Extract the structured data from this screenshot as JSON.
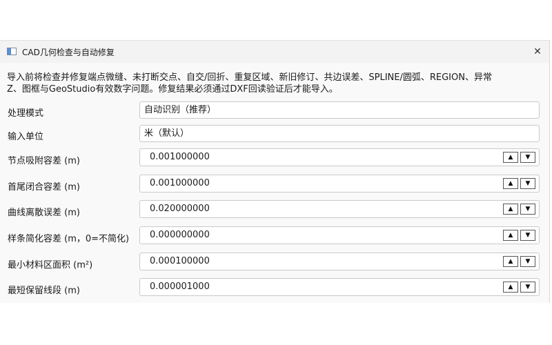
{
  "window": {
    "title": "CAD几何检查与自动修复",
    "close_glyph": "✕"
  },
  "intro": {
    "line1": "导入前将检查并修复端点微缝、未打断交点、自交/回折、重复区域、新旧修订、共边误差、SPLINE/圆弧、REGION、异常",
    "line2": "Z、图框与GeoStudio有效数字问题。修复结果必须通过DXF回读验证后才能导入。"
  },
  "fields": {
    "mode": {
      "label": "处理模式",
      "value": "自动识别（推荐）"
    },
    "unit": {
      "label": "输入单位",
      "value": "米（默认）"
    },
    "snap_tol": {
      "label": "节点吸附容差 (m)",
      "value": "0.001000000"
    },
    "close_tol": {
      "label": "首尾闭合容差 (m)",
      "value": "0.001000000"
    },
    "curve_err": {
      "label": "曲线离散误差 (m)",
      "value": "0.020000000"
    },
    "spline_tol": {
      "label": "样条简化容差 (m，0=不简化)",
      "value": "0.000000000"
    },
    "min_area": {
      "label": "最小材料区面积 (m²)",
      "value": "0.000100000"
    },
    "min_seg": {
      "label": "最短保留线段 (m)",
      "value": "0.000001000"
    }
  },
  "spinner": {
    "up_glyph": "▲",
    "down_glyph": "▼"
  },
  "icons": {
    "app": "app-window-icon",
    "close": "close-icon"
  }
}
